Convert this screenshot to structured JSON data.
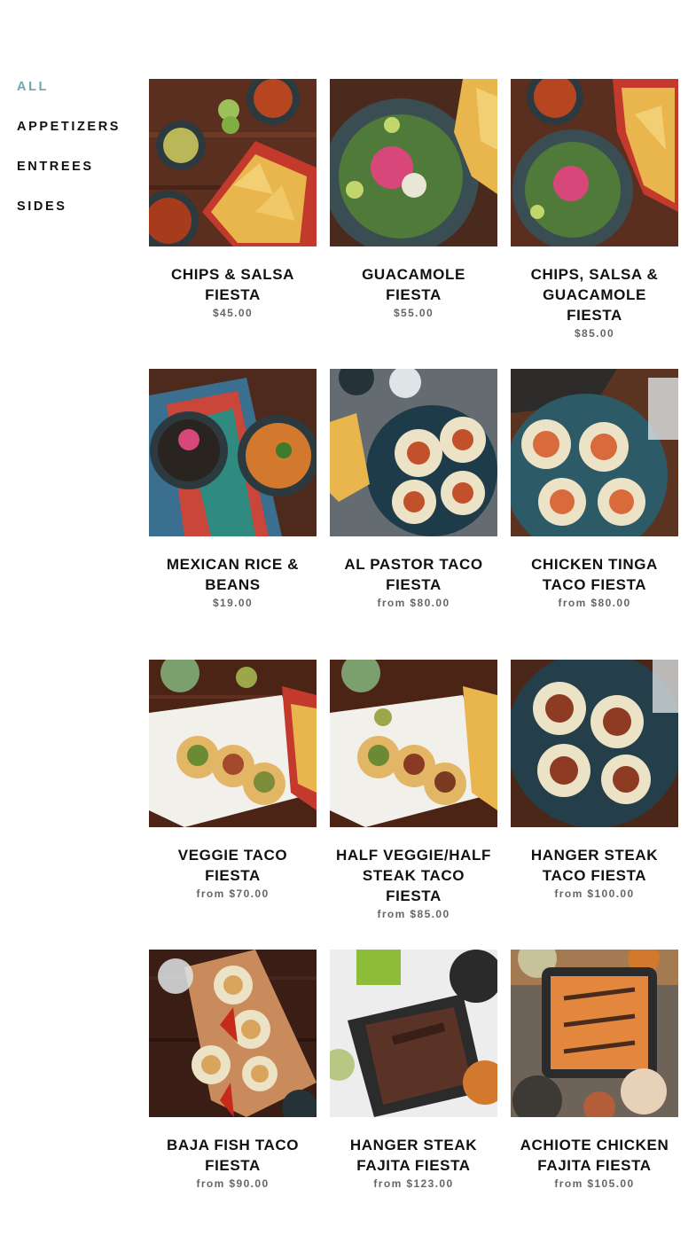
{
  "categories": {
    "all": "ALL",
    "appetizers": "APPETIZERS",
    "entrees": "ENTREES",
    "sides": "SIDES",
    "active_color": "#6aa7b0"
  },
  "products": [
    {
      "title": "CHIPS & SALSA FIESTA",
      "price": "$45.00",
      "image_icon": "chips-salsa-photo"
    },
    {
      "title": "GUACAMOLE FIESTA",
      "price": "$55.00",
      "image_icon": "guacamole-photo"
    },
    {
      "title": "CHIPS, SALSA & GUACAMOLE FIESTA",
      "price": "$85.00",
      "image_icon": "chips-salsa-guac-photo"
    },
    {
      "title": "MEXICAN RICE & BEANS",
      "price": "$19.00",
      "image_icon": "rice-beans-photo"
    },
    {
      "title": "AL PASTOR TACO FIESTA",
      "price": "from $80.00",
      "image_icon": "al-pastor-tacos-photo"
    },
    {
      "title": "CHICKEN TINGA TACO FIESTA",
      "price": "from $80.00",
      "image_icon": "chicken-tinga-tacos-photo"
    },
    {
      "title": "VEGGIE TACO FIESTA",
      "price": "from $70.00",
      "image_icon": "veggie-tacos-photo"
    },
    {
      "title": "HALF VEGGIE/HALF STEAK TACO FIESTA",
      "price": "from $85.00",
      "image_icon": "half-veggie-half-steak-photo"
    },
    {
      "title": "HANGER STEAK TACO FIESTA",
      "price": "from $100.00",
      "image_icon": "hanger-steak-tacos-photo"
    },
    {
      "title": "BAJA FISH TACO FIESTA",
      "price": "from $90.00",
      "image_icon": "baja-fish-tacos-photo"
    },
    {
      "title": "HANGER STEAK FAJITA FIESTA",
      "price": "from $123.00",
      "image_icon": "hanger-steak-fajita-photo"
    },
    {
      "title": "ACHIOTE CHICKEN FAJITA FIESTA",
      "price": "from $105.00",
      "image_icon": "achiote-chicken-fajita-photo"
    }
  ]
}
